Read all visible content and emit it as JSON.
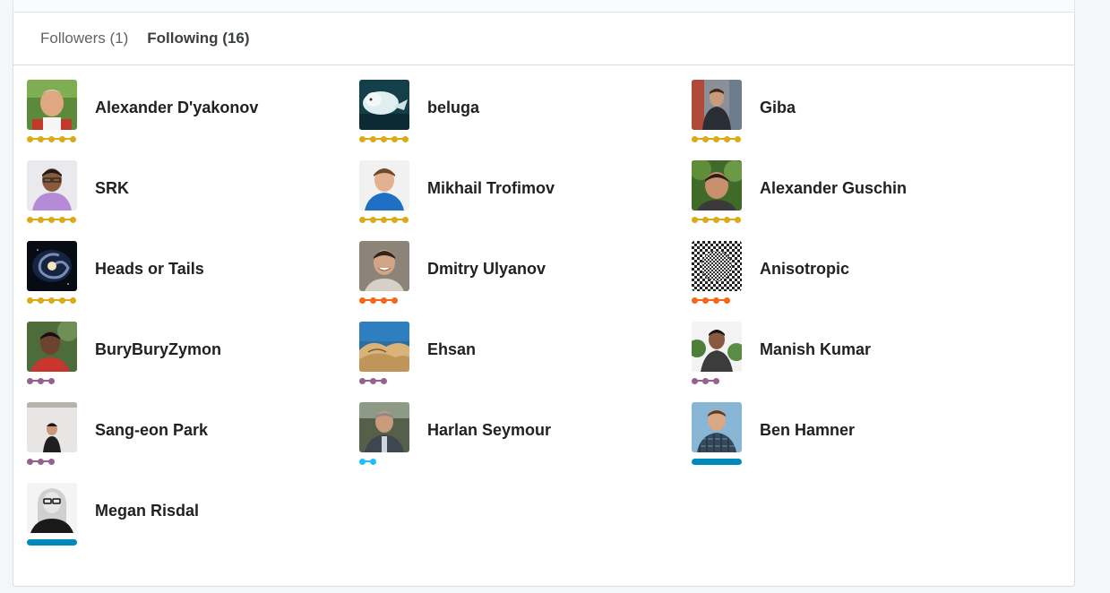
{
  "tabs": {
    "followers": "Followers (1)",
    "following": "Following (16)"
  },
  "tier_colors": {
    "grandmaster": "#dca917",
    "master": "#f96517",
    "expert": "#95628f",
    "contributor": "#20beff",
    "staff": "#008abc"
  },
  "users": [
    {
      "name": "Alexander D'yakonov",
      "tier": "grandmaster",
      "dots": 5,
      "avatar": "person-helmet-avatar"
    },
    {
      "name": "beluga",
      "tier": "grandmaster",
      "dots": 5,
      "avatar": "beluga-whale-avatar"
    },
    {
      "name": "Giba",
      "tier": "grandmaster",
      "dots": 5,
      "avatar": "person-street-avatar"
    },
    {
      "name": "SRK",
      "tier": "grandmaster",
      "dots": 5,
      "avatar": "person-glasses-avatar"
    },
    {
      "name": "Mikhail Trofimov",
      "tier": "grandmaster",
      "dots": 5,
      "avatar": "person-blue-shirt-avatar"
    },
    {
      "name": "Alexander Guschin",
      "tier": "grandmaster",
      "dots": 5,
      "avatar": "person-trees-avatar"
    },
    {
      "name": "Heads or Tails",
      "tier": "grandmaster",
      "dots": 5,
      "avatar": "spiral-galaxy-avatar"
    },
    {
      "name": "Dmitry Ulyanov",
      "tier": "master",
      "dots": 4,
      "avatar": "person-smiling-avatar"
    },
    {
      "name": "Anisotropic",
      "tier": "master",
      "dots": 4,
      "avatar": "optical-pattern-avatar"
    },
    {
      "name": "BuryBuryZymon",
      "tier": "expert",
      "dots": 3,
      "avatar": "person-red-shirt-avatar"
    },
    {
      "name": "Ehsan",
      "tier": "expert",
      "dots": 3,
      "avatar": "desert-dunes-avatar"
    },
    {
      "name": "Manish Kumar",
      "tier": "expert",
      "dots": 3,
      "avatar": "person-garden-avatar"
    },
    {
      "name": "Sang-eon Park",
      "tier": "expert",
      "dots": 3,
      "avatar": "person-whiteboard-avatar"
    },
    {
      "name": "Harlan Seymour",
      "tier": "contributor",
      "dots": 2,
      "avatar": "person-outdoor-avatar"
    },
    {
      "name": "Ben Hamner",
      "tier": "staff",
      "dots": 0,
      "avatar": "person-plaid-shirt-avatar"
    },
    {
      "name": "Megan Risdal",
      "tier": "staff",
      "dots": 0,
      "avatar": "person-bw-glasses-avatar"
    }
  ]
}
